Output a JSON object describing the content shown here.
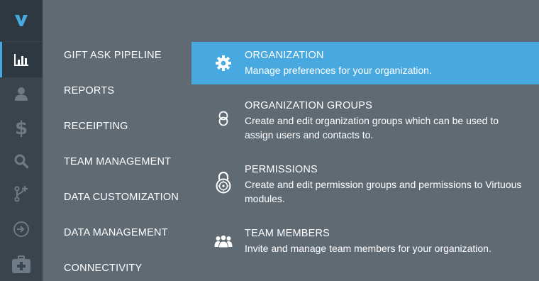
{
  "colors": {
    "rail": "#3a444d",
    "rail_active": "#2e3841",
    "panel": "#5f6a73",
    "accent": "#48a9e0",
    "text": "#ffffff"
  },
  "rail": {
    "logo_icon": "virtuous-logo-icon",
    "items": [
      {
        "icon": "bar-chart-icon",
        "active": true
      },
      {
        "icon": "person-icon",
        "active": false
      },
      {
        "icon": "dollar-icon",
        "active": false
      },
      {
        "icon": "search-icon",
        "active": false
      },
      {
        "icon": "branch-plus-icon",
        "active": false
      },
      {
        "icon": "sign-in-icon",
        "active": false
      },
      {
        "icon": "medical-kit-icon",
        "active": false
      }
    ]
  },
  "menu": {
    "items": [
      {
        "label": "GIFT ASK PIPELINE"
      },
      {
        "label": "REPORTS"
      },
      {
        "label": "RECEIPTING"
      },
      {
        "label": "TEAM MANAGEMENT"
      },
      {
        "label": "DATA CUSTOMIZATION"
      },
      {
        "label": "DATA MANAGEMENT"
      },
      {
        "label": "CONNECTIVITY"
      }
    ]
  },
  "settings": [
    {
      "icon": "gear-icon",
      "title": "ORGANIZATION",
      "description": "Manage preferences for your organization.",
      "active": true
    },
    {
      "icon": "linked-circles-icon",
      "title": "ORGANIZATION GROUPS",
      "description": "Create and edit organization groups which can be used to assign users and contacts to.",
      "active": false
    },
    {
      "icon": "padlock-icon",
      "title": "PERMISSIONS",
      "description": "Create and edit permission groups and permissions to Virtuous modules.",
      "active": false
    },
    {
      "icon": "team-icon",
      "title": "TEAM MEMBERS",
      "description": "Invite and manage team members for your organization.",
      "active": false
    }
  ]
}
